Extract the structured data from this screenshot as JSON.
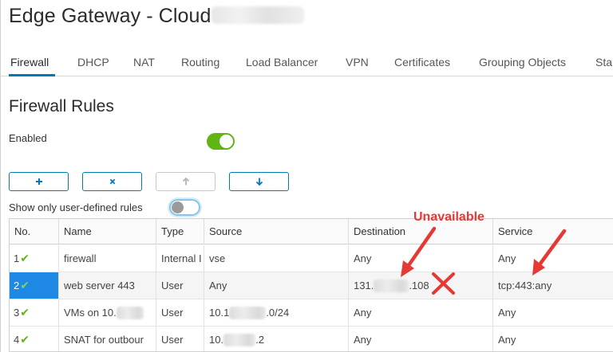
{
  "header": {
    "title": "Edge Gateway - Cloud"
  },
  "tabs": [
    {
      "label": "Firewall",
      "active": true
    },
    {
      "label": "DHCP"
    },
    {
      "label": "NAT"
    },
    {
      "label": "Routing"
    },
    {
      "label": "Load Balancer"
    },
    {
      "label": "VPN"
    },
    {
      "label": "Certificates"
    },
    {
      "label": "Grouping Objects"
    },
    {
      "label": "Sta"
    }
  ],
  "section": {
    "title": "Firewall Rules",
    "enabled_label": "Enabled",
    "enabled_on": true,
    "show_user_defined_label": "Show only user-defined rules",
    "show_user_defined_on": false
  },
  "toolbar": {
    "add_icon": "plus-icon",
    "delete_icon": "x-icon",
    "move_up_icon": "arrow-up-icon",
    "move_down_icon": "arrow-down-icon"
  },
  "table": {
    "columns": [
      "No.",
      "Name",
      "Type",
      "Source",
      "Destination",
      "Service"
    ],
    "rows": [
      {
        "no": "1",
        "name": "firewall",
        "type": "Internal I",
        "source": "vse",
        "destination": "Any",
        "service": "Any"
      },
      {
        "no": "2",
        "name": "web server 443",
        "type": "User",
        "source": "Any",
        "dest_prefix": "131.",
        "dest_suffix": ".108",
        "service": "tcp:443:any"
      },
      {
        "no": "3",
        "name_prefix": "VMs on 10.",
        "type": "User",
        "src_prefix": "10.1",
        "src_suffix": ".0/24",
        "destination": "Any",
        "service": "Any"
      },
      {
        "no": "4",
        "name": "SNAT for outbour",
        "type": "User",
        "src_prefix": "10.",
        "src_suffix": ".2",
        "destination": "Any",
        "service": "Any"
      }
    ]
  },
  "annotation": {
    "label": "Unavailable",
    "color": "#e53935"
  },
  "colors": {
    "accent": "#0079b8",
    "selected_row": "#1e88e5",
    "toggle_on": "#60b515",
    "check": "#60b515"
  }
}
